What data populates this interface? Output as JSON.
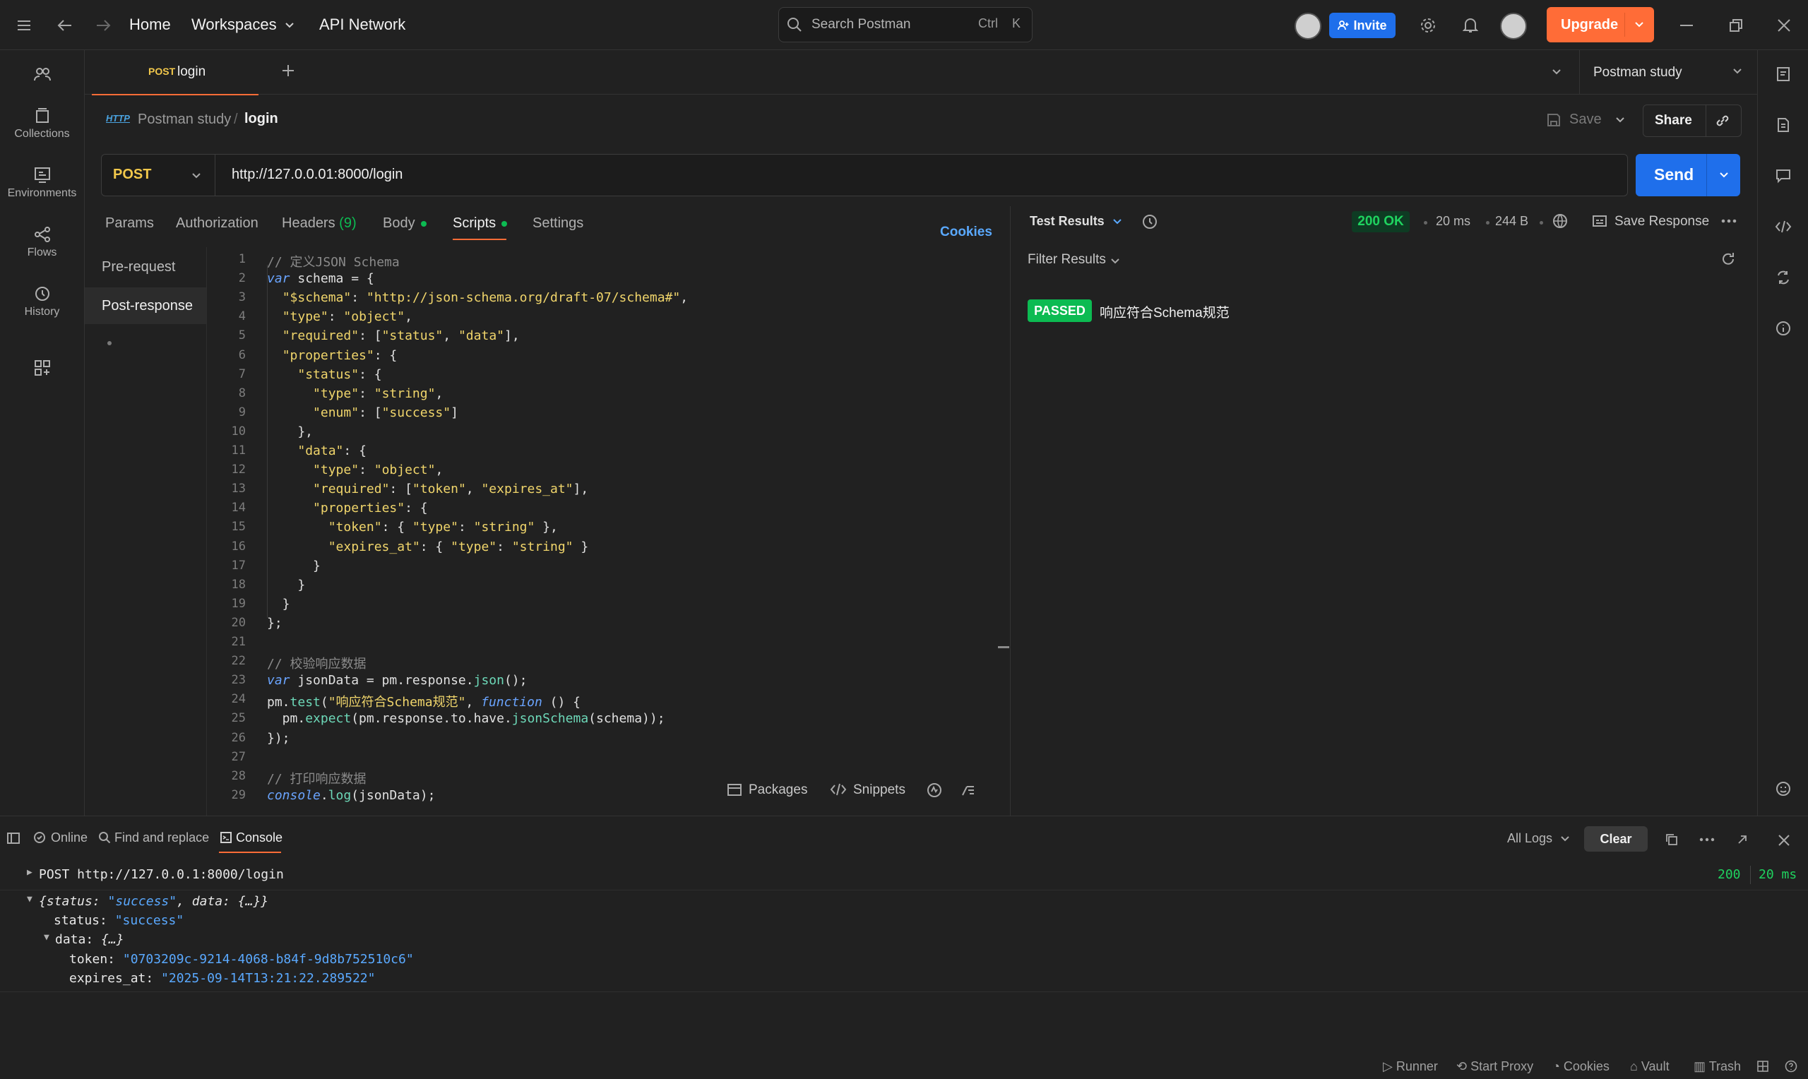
{
  "topbar": {
    "nav_home": "Home",
    "nav_workspaces": "Workspaces",
    "nav_api_network": "API Network",
    "search_placeholder": "Search Postman",
    "shortcut_ctrl": "Ctrl",
    "shortcut_k": "K",
    "invite_label": "Invite",
    "upgrade_label": "Upgrade"
  },
  "sidebar": {
    "items": [
      {
        "label": "Collections",
        "icon": "collections-icon"
      },
      {
        "label": "Environments",
        "icon": "environments-icon"
      },
      {
        "label": "Flows",
        "icon": "flows-icon"
      },
      {
        "label": "History",
        "icon": "history-icon"
      }
    ]
  },
  "tabs": {
    "active_method": "POST",
    "active_name": "login",
    "workspace_env": "Postman study"
  },
  "breadcrumb": {
    "badge": "HTTP",
    "collection": "Postman study",
    "separator": "/",
    "request": "login",
    "save_label": "Save",
    "share_label": "Share"
  },
  "request": {
    "method": "POST",
    "url": "http://127.0.0.01:8000/login",
    "send_label": "Send",
    "tabs": {
      "params": "Params",
      "authorization": "Authorization",
      "headers": "Headers",
      "headers_count": "(9)",
      "body": "Body",
      "scripts": "Scripts",
      "settings": "Settings"
    },
    "cookies_label": "Cookies"
  },
  "scripts": {
    "nav": [
      "Pre-request",
      "Post-response"
    ],
    "lines": [
      "// 定义JSON Schema",
      "var schema = {",
      "  \"$schema\": \"http://json-schema.org/draft-07/schema#\",",
      "  \"type\": \"object\",",
      "  \"required\": [\"status\", \"data\"],",
      "  \"properties\": {",
      "    \"status\": {",
      "      \"type\": \"string\",",
      "      \"enum\": [\"success\"]",
      "    },",
      "    \"data\": {",
      "      \"type\": \"object\",",
      "      \"required\": [\"token\", \"expires_at\"],",
      "      \"properties\": {",
      "        \"token\": { \"type\": \"string\" },",
      "        \"expires_at\": { \"type\": \"string\" }",
      "      }",
      "    }",
      "  }",
      "};",
      "",
      "// 校验响应数据",
      "var jsonData = pm.response.json();",
      "pm.test(\"响应符合Schema规范\", function () {",
      "  pm.expect(pm.response.to.have.jsonSchema(schema));",
      "});",
      "",
      "// 打印响应数据",
      "console.log(jsonData);"
    ],
    "packages_label": "Packages",
    "snippets_label": "Snippets"
  },
  "response": {
    "tab_label": "Test Results",
    "status": "200 OK",
    "time": "20 ms",
    "size": "244 B",
    "save_response_label": "Save Response",
    "filter_label": "Filter Results",
    "results": [
      {
        "status": "PASSED",
        "name": "响应符合Schema规范"
      }
    ]
  },
  "console": {
    "online_label": "Online",
    "find_replace_label": "Find and replace",
    "console_label": "Console",
    "all_logs_label": "All Logs",
    "clear_label": "Clear",
    "request_line": "POST http://127.0.0.1:8000/login",
    "request_status": "200",
    "request_time": "20 ms",
    "obj_summary_a": "{status: ",
    "obj_summary_b": "\"success\"",
    "obj_summary_c": ", data: {…}}",
    "status_key": "status: ",
    "status_val": "\"success\"",
    "data_key": "data: ",
    "data_val": "{…}",
    "token_key": "token: ",
    "token_val": "\"0703209c-9214-4068-b84f-9d8b752510c6\"",
    "expires_key": "expires_at: ",
    "expires_val": "\"2025-09-14T13:21:22.289522\""
  },
  "statusbar": {
    "runner": "Runner",
    "start_proxy": "Start Proxy",
    "cookies": "Cookies",
    "vault": "Vault",
    "trash": "Trash"
  },
  "colors": {
    "accent": "#ff6c37",
    "primary": "#1f6feb",
    "success": "#0cbb52"
  }
}
